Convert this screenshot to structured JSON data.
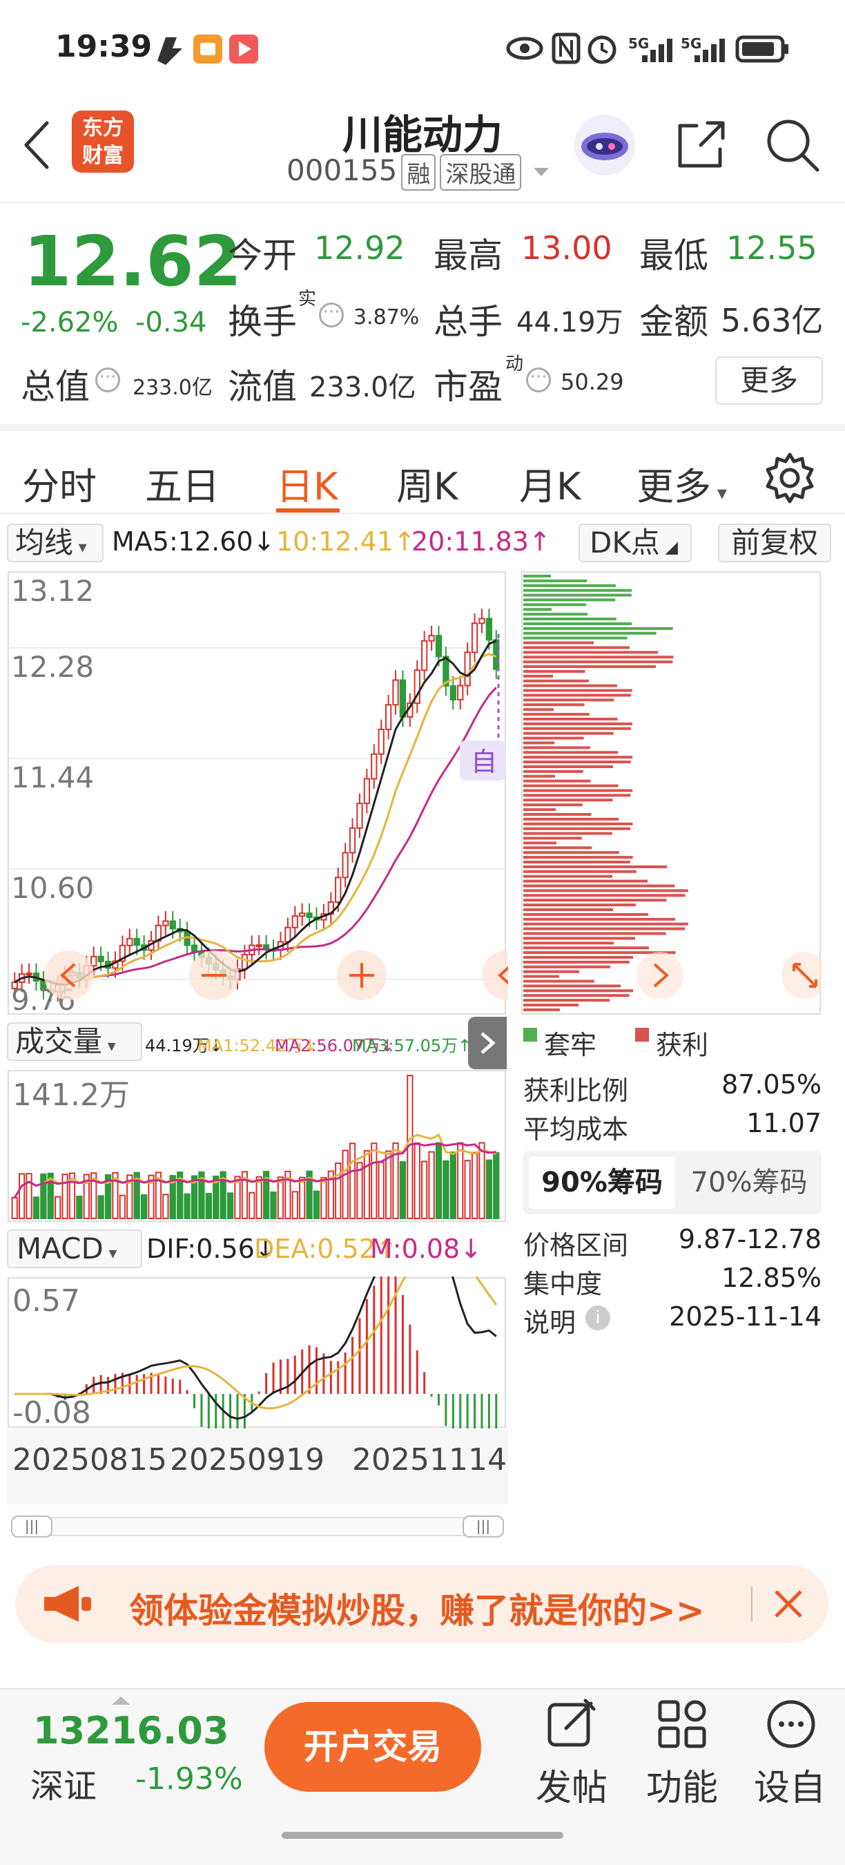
{
  "status_bar": {
    "time": "19:39",
    "network": "5G"
  },
  "header": {
    "title": "川能动力",
    "code": "000155",
    "tags": [
      "融",
      "深股通"
    ],
    "logo_text": [
      "东方",
      "财富"
    ]
  },
  "quote": {
    "price": "12.62",
    "change_pct": "-2.62%",
    "change_abs": "-0.34",
    "open_label": "今开",
    "open": "12.92",
    "high_label": "最高",
    "high": "13.00",
    "low_label": "最低",
    "low": "12.55",
    "turnover_label": "换手",
    "turnover_sup": "实",
    "turnover": "3.87%",
    "volume_label": "总手",
    "volume": "44.19万",
    "amount_label": "金额",
    "amount": "5.63亿",
    "total_mv_label": "总值",
    "total_mv": "233.0亿",
    "float_mv_label": "流值",
    "float_mv": "233.0亿",
    "pe_label": "市盈",
    "pe_sup": "动",
    "pe": "50.29",
    "more_label": "更多"
  },
  "tabs": [
    "分时",
    "五日",
    "日K",
    "周K",
    "月K",
    "更多"
  ],
  "active_tab": "日K",
  "kline": {
    "ma_select": "均线",
    "ma5": "MA5:12.60↓",
    "ma10": "10:12.41↑",
    "ma20": "20:11.83↑",
    "dk_label": "DK点",
    "adjust_label": "前复权",
    "y_ticks": [
      "13.12",
      "12.28",
      "11.44",
      "10.60",
      "9.76"
    ],
    "marker": "自",
    "colors": {
      "ma5": "#222222",
      "ma10": "#e8b33a",
      "ma20": "#c52a8a",
      "up": "#d9302c",
      "down": "#2e9a3c"
    }
  },
  "volume": {
    "select": "成交量",
    "vol": "44.19万↓",
    "ma1": "MA1:52.42万↓",
    "ma2": "MA2:56.07万↓",
    "ma3": "MA3:57.05万↑",
    "max_label": "141.2万"
  },
  "macd": {
    "select": "MACD",
    "dif": "DIF:0.56↓",
    "dea": "DEA:0.52↑",
    "m": "M:0.08↓",
    "max_label": "0.57",
    "min_label": "-0.08"
  },
  "dates": [
    "20250815",
    "20250919",
    "20251114"
  ],
  "chips": {
    "legend_loss": "套牢",
    "legend_profit": "获利",
    "rows": [
      {
        "label": "获利比例",
        "value": "87.05%"
      },
      {
        "label": "平均成本",
        "value": "11.07"
      }
    ],
    "tab_90": "90%筹码",
    "tab_70": "70%筹码",
    "rows2": [
      {
        "label": "价格区间",
        "value": "9.87-12.78"
      },
      {
        "label": "集中度",
        "value": "12.85%"
      },
      {
        "label": "说明",
        "value": "2025-11-14"
      }
    ]
  },
  "banner": {
    "text": "领体验金模拟炒股，赚了就是你的>>"
  },
  "bottom": {
    "index_value": "13216.03",
    "index_name": "深证",
    "index_change": "-1.93%",
    "trade_label": "开户交易",
    "actions": [
      "发帖",
      "功能",
      "设自"
    ]
  }
}
